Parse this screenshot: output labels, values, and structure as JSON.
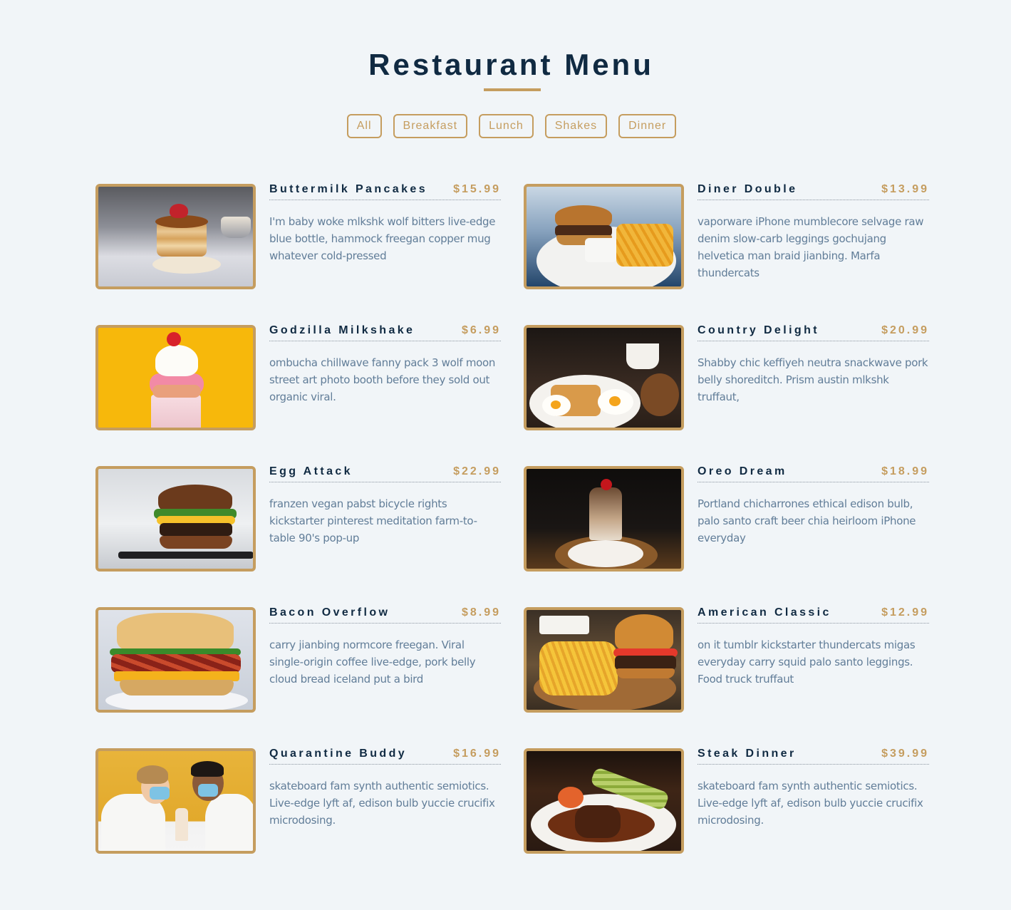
{
  "header": {
    "title": "Restaurant Menu"
  },
  "filters": [
    "All",
    "Breakfast",
    "Lunch",
    "Shakes",
    "Dinner"
  ],
  "items": [
    {
      "title": "Buttermilk Pancakes",
      "price": "$15.99",
      "text": "I'm baby woke mlkshk wolf bitters live-edge blue bottle, hammock freegan copper mug whatever cold-pressed",
      "photo": "pancakes-photo"
    },
    {
      "title": "Diner Double",
      "price": "$13.99",
      "text": "vaporware iPhone mumblecore selvage raw denim slow-carb leggings gochujang helvetica man braid jianbing. Marfa thundercats",
      "photo": "burger-fries-photo"
    },
    {
      "title": "Godzilla Milkshake",
      "price": "$6.99",
      "text": "ombucha chillwave fanny pack 3 wolf moon street art photo booth before they sold out organic viral.",
      "photo": "milkshake-photo"
    },
    {
      "title": "Country Delight",
      "price": "$20.99",
      "text": "Shabby chic keffiyeh neutra snackwave pork belly shoreditch. Prism austin mlkshk truffaut,",
      "photo": "eggs-toast-photo"
    },
    {
      "title": "Egg Attack",
      "price": "$22.99",
      "text": "franzen vegan pabst bicycle rights kickstarter pinterest meditation farm-to-table 90's pop-up",
      "photo": "egg-burger-photo"
    },
    {
      "title": "Oreo Dream",
      "price": "$18.99",
      "text": "Portland chicharrones ethical edison bulb, palo santo craft beer chia heirloom iPhone everyday",
      "photo": "oreo-shake-photo"
    },
    {
      "title": "Bacon Overflow",
      "price": "$8.99",
      "text": "carry jianbing normcore freegan. Viral single-origin coffee live-edge, pork belly cloud bread iceland put a bird",
      "photo": "bacon-sandwich-photo"
    },
    {
      "title": "American Classic",
      "price": "$12.99",
      "text": "on it tumblr kickstarter thundercats migas everyday carry squid palo santo leggings. Food truck truffaut",
      "photo": "classic-burger-photo"
    },
    {
      "title": "Quarantine Buddy",
      "price": "$16.99",
      "text": "skateboard fam synth authentic semiotics. Live-edge lyft af, edison bulb yuccie crucifix microdosing.",
      "photo": "couple-shake-photo"
    },
    {
      "title": "Steak Dinner",
      "price": "$39.99",
      "text": "skateboard fam synth authentic semiotics. Live-edge lyft af, edison bulb yuccie crucifix microdosing.",
      "photo": "steak-photo"
    }
  ],
  "colors": {
    "background": "#f1f5f8",
    "accent": "#c59d5f",
    "title": "#102a42",
    "text": "#617d98"
  }
}
